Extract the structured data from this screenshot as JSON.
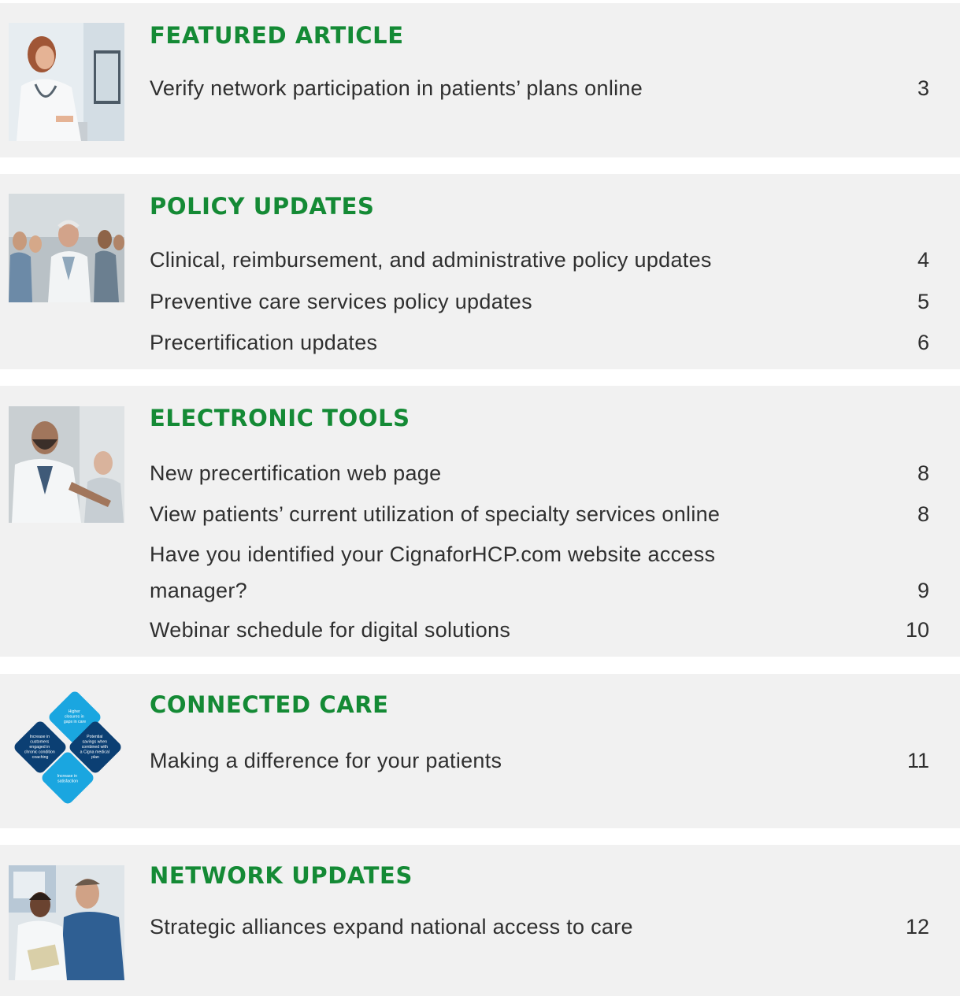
{
  "sections": [
    {
      "heading": "FEATURED ARTICLE",
      "items": [
        {
          "title": "Verify network participation in patients’ plans online",
          "page": "3"
        }
      ]
    },
    {
      "heading": "POLICY UPDATES",
      "items": [
        {
          "title": "Clinical, reimbursement, and administrative policy updates",
          "page": "4"
        },
        {
          "title": "Preventive care services policy updates",
          "page": "5"
        },
        {
          "title": "Precertification updates",
          "page": "6"
        }
      ]
    },
    {
      "heading": "ELECTRONIC TOOLS",
      "items": [
        {
          "title": "New precertification web page",
          "page": "8"
        },
        {
          "title": "View patients’ current utilization of specialty services online",
          "page": "8"
        },
        {
          "title": "Have you identified your CignaforHCP.com website access manager?",
          "page": "9"
        },
        {
          "title": "Webinar schedule for digital solutions",
          "page": "10"
        }
      ]
    },
    {
      "heading": "CONNECTED CARE",
      "items": [
        {
          "title": "Making a difference for your patients",
          "page": "11"
        }
      ]
    },
    {
      "heading": "NETWORK UPDATES",
      "items": [
        {
          "title": "Strategic alliances expand national access to care",
          "page": "12"
        }
      ]
    }
  ],
  "diamond_labels": {
    "top": [
      "Higher",
      "closures in",
      "gaps in care"
    ],
    "left": [
      "Increase in",
      "customers",
      "engaged in",
      "chronic condition",
      "coaching"
    ],
    "right": [
      "Potential",
      "savings when",
      "combined with",
      "a Cigna medical",
      "plan"
    ],
    "bottom": [
      "Increase in",
      "satisfaction"
    ]
  },
  "colors": {
    "heading_green": "#148a35",
    "section_bg": "#f1f1f1",
    "text": "#2f2f2f",
    "diamond_light": "#1aa6e0",
    "diamond_dark": "#0b3f73"
  }
}
